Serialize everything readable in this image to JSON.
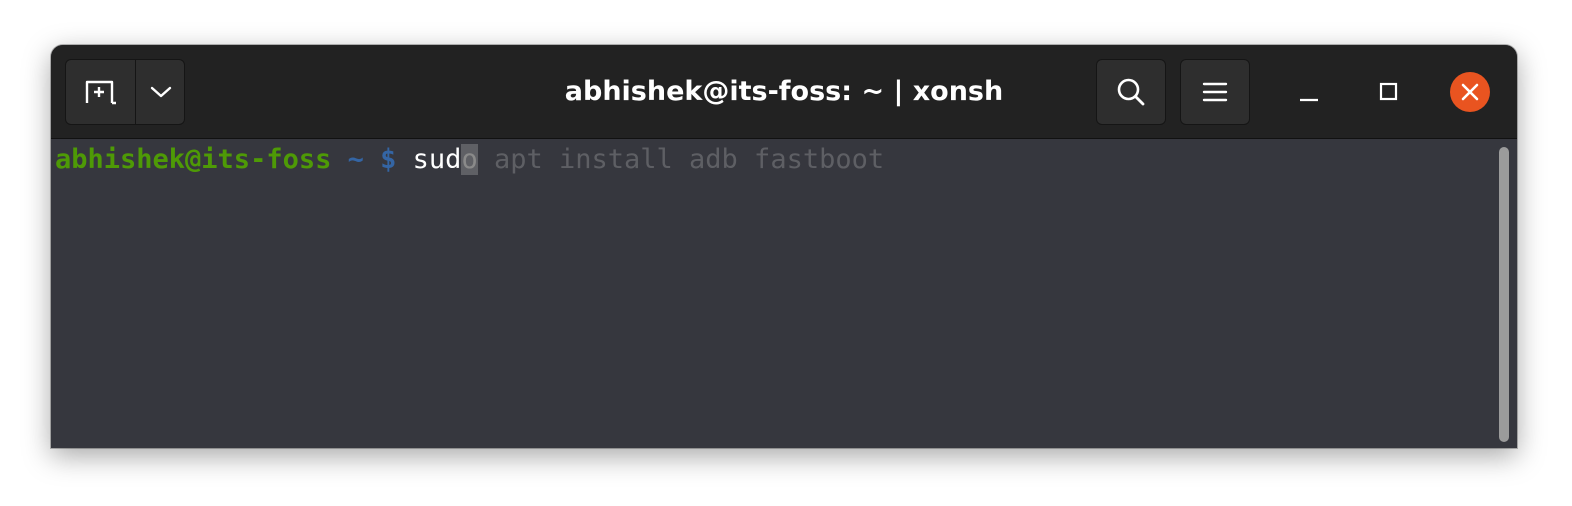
{
  "window": {
    "title": "abhishek@its-foss: ~ | xonsh"
  },
  "terminal": {
    "prompt_user_host": "abhishek@its-foss",
    "prompt_path": "~",
    "prompt_symbol": "$",
    "typed": "sud",
    "cursor_char": "o",
    "suggestion": " apt install adb fastboot"
  },
  "icons": {
    "new_tab": "new-tab-icon",
    "dropdown": "chevron-down-icon",
    "search": "search-icon",
    "menu": "hamburger-menu-icon",
    "minimize": "minimize-icon",
    "maximize": "maximize-icon",
    "close": "close-icon"
  },
  "colors": {
    "titlebar": "#222222",
    "terminal_bg": "#36373e",
    "prompt_user": "#4e9a06",
    "prompt_path": "#3465a4",
    "close_button": "#e95420"
  }
}
